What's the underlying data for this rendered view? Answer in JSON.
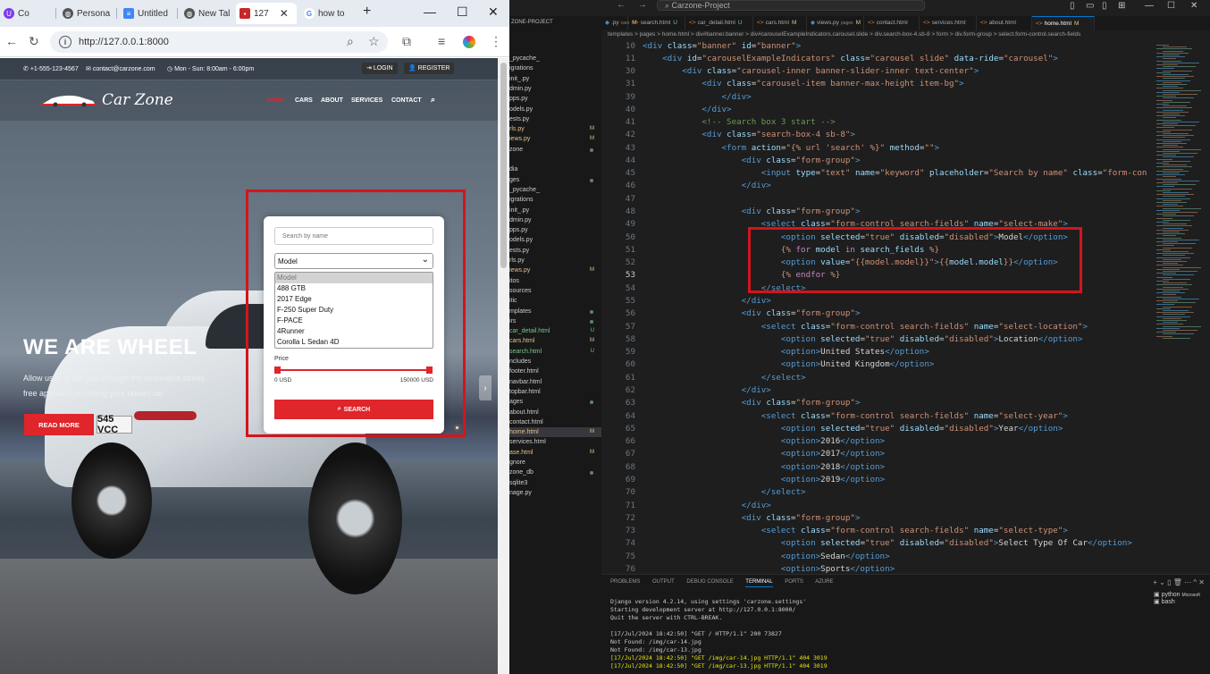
{
  "browser": {
    "tabs": [
      {
        "label": "Co",
        "icon": "udemy-icon"
      },
      {
        "label": "Persona",
        "icon": "globe-icon"
      },
      {
        "label": "Untitled",
        "icon": "docs-icon"
      },
      {
        "label": "New Tal",
        "icon": "globe-icon"
      },
      {
        "label": "127",
        "icon": "carzone-icon"
      },
      {
        "label": "how to",
        "icon": "google-icon"
      }
    ],
    "url": "http://127.0.0.1:8000"
  },
  "site": {
    "topbar": {
      "phone": "+1-555-123-4567",
      "email": "contact@carzone.com",
      "hours": "Mon - Sun: 8:00am - 6:00pm",
      "login": "LOGIN",
      "register": "REGISTER"
    },
    "logo": "Car Zone",
    "nav": [
      "HOME",
      "CARS",
      "ABOUT",
      "SERVICES",
      "CONTACT"
    ],
    "hero": {
      "title": "WE ARE WHEEL",
      "sub1": "Allow us to guide you through the innovative stress",
      "sub2": "free approach in finding your dream car.",
      "read_more": "READ MORE"
    },
    "plate": "545 VCC",
    "search": {
      "placeholder": "Search by name",
      "model_selected": "Model",
      "options": [
        "Model",
        "488 GTB",
        "2017 Edge",
        "F-250 Super Duty",
        "F-PACE",
        "4Runner",
        "Corolla L Sedan 4D"
      ],
      "price_label": "Price",
      "price_min": "0 USD",
      "price_max": "150000 USD",
      "search_button": "SEARCH"
    }
  },
  "vscode": {
    "title": "Carzone-Project",
    "sidebar_header": "ZONE-PROJECT",
    "sidebar_items": [
      {
        "label": "_pycache_",
        "mark": ""
      },
      {
        "label": "igrations",
        "mark": ""
      },
      {
        "label": "init_.py",
        "mark": ""
      },
      {
        "label": "dmin.py",
        "mark": ""
      },
      {
        "label": "pps.py",
        "mark": ""
      },
      {
        "label": "odels.py",
        "mark": ""
      },
      {
        "label": "ests.py",
        "mark": ""
      },
      {
        "label": "rls.py",
        "mark": "M"
      },
      {
        "label": "iews.py",
        "mark": "M"
      },
      {
        "label": "zone",
        "mark": "dot"
      },
      {
        "label": "",
        "mark": ""
      },
      {
        "label": "dia",
        "mark": ""
      },
      {
        "label": "ges",
        "mark": "dot"
      },
      {
        "label": "_pycache_",
        "mark": ""
      },
      {
        "label": "igrations",
        "mark": ""
      },
      {
        "label": "init_.py",
        "mark": ""
      },
      {
        "label": "dmin.py",
        "mark": ""
      },
      {
        "label": "pps.py",
        "mark": ""
      },
      {
        "label": "odels.py",
        "mark": ""
      },
      {
        "label": "ests.py",
        "mark": ""
      },
      {
        "label": "rls.py",
        "mark": ""
      },
      {
        "label": "iews.py",
        "mark": "M"
      },
      {
        "label": "itos",
        "mark": ""
      },
      {
        "label": "sources",
        "mark": ""
      },
      {
        "label": "itic",
        "mark": ""
      },
      {
        "label": "mplates",
        "mark": "dot"
      },
      {
        "label": "irs",
        "mark": "dot"
      },
      {
        "label": "car_detail.html",
        "mark": "U"
      },
      {
        "label": "cars.html",
        "mark": "M"
      },
      {
        "label": "search.html",
        "mark": "U"
      },
      {
        "label": "ncludes",
        "mark": ""
      },
      {
        "label": "footer.html",
        "mark": ""
      },
      {
        "label": "navbar.html",
        "mark": ""
      },
      {
        "label": "topbar.html",
        "mark": ""
      },
      {
        "label": "ages",
        "mark": "dot"
      },
      {
        "label": "about.html",
        "mark": ""
      },
      {
        "label": "contact.html",
        "mark": ""
      },
      {
        "label": "home.html",
        "mark": "M"
      },
      {
        "label": "services.html",
        "mark": ""
      },
      {
        "label": "ase.html",
        "mark": "M"
      },
      {
        "label": "gnore",
        "mark": ""
      },
      {
        "label": "zone_db",
        "mark": "dot"
      },
      {
        "label": "sqlite3",
        "mark": ""
      },
      {
        "label": "nage.py",
        "mark": ""
      }
    ],
    "tabs": [
      {
        "label": ".py",
        "extra": "cars",
        "mark": "M"
      },
      {
        "label": "search.html",
        "extra": "",
        "mark": "U"
      },
      {
        "label": "car_detail.html",
        "extra": "",
        "mark": "U"
      },
      {
        "label": "cars.html",
        "extra": "",
        "mark": "M"
      },
      {
        "label": "views.py",
        "extra": "pages",
        "mark": "M"
      },
      {
        "label": "contact.html",
        "extra": "",
        "mark": ""
      },
      {
        "label": "services.html",
        "extra": "",
        "mark": ""
      },
      {
        "label": "about.html",
        "extra": "",
        "mark": ""
      },
      {
        "label": "home.html",
        "extra": "",
        "mark": "M"
      }
    ],
    "breadcrumb": "templates > pages > home.html > div#banner.banner > div#carouselExampleIndicators.carousel.slide > div.search-box-4.sb-8 > form > div.form-group > select.form-control.search-fields",
    "panel_tabs": [
      "PROBLEMS",
      "OUTPUT",
      "DEBUG CONSOLE",
      "TERMINAL",
      "PORTS",
      "AZURE"
    ],
    "terminal_lines": [
      "Django version 4.2.14, using settings 'carzone.settings'",
      "Starting development server at http://127.0.0.1:8000/",
      "Quit the server with CTRL-BREAK.",
      "",
      "[17/Jul/2024 18:42:50] \"GET / HTTP/1.1\" 200 73827",
      "Not Found: /img/car-14.jpg",
      "Not Found: /img/car-13.jpg",
      "[17/Jul/2024 18:42:50] \"GET /img/car-14.jpg HTTP/1.1\" 404 3019",
      "[17/Jul/2024 18:42:50] \"GET /img/car-13.jpg HTTP/1.1\" 404 3019"
    ],
    "terminal_list": [
      "python",
      "Microsoft",
      "bash"
    ]
  }
}
